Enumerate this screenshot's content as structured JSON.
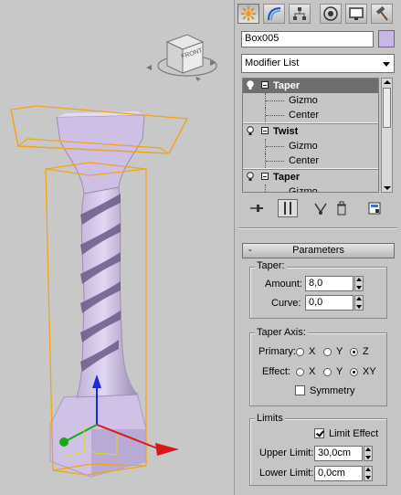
{
  "viewport": {
    "viewcube_face": "FRONT"
  },
  "command_panel": {
    "tabs": [
      {
        "name": "create",
        "icon": "sun-icon"
      },
      {
        "name": "modify",
        "icon": "modify-arc-icon"
      },
      {
        "name": "hierarchy",
        "icon": "hierarchy-icon"
      },
      {
        "name": "motion",
        "icon": "motion-icon"
      },
      {
        "name": "display",
        "icon": "display-monitor-icon"
      },
      {
        "name": "utilities",
        "icon": "hammer-icon"
      }
    ],
    "object_name": "Box005",
    "object_color": "#c8b6e8",
    "modifier_list_label": "Modifier List",
    "stack": [
      {
        "label": "Taper",
        "type": "modifier",
        "selected": true
      },
      {
        "label": "Gizmo",
        "type": "sub"
      },
      {
        "label": "Center",
        "type": "sub"
      },
      {
        "label": "Twist",
        "type": "modifier"
      },
      {
        "label": "Gizmo",
        "type": "sub"
      },
      {
        "label": "Center",
        "type": "sub"
      },
      {
        "label": "Taper",
        "type": "modifier"
      },
      {
        "label": "Gizmo",
        "type": "sub"
      }
    ]
  },
  "parameters": {
    "rollout_sign": "-",
    "rollout_title": "Parameters",
    "taper_group": "Taper:",
    "amount_label": "Amount:",
    "amount_value": "8,0",
    "curve_label": "Curve:",
    "curve_value": "0,0",
    "axis_group": "Taper Axis:",
    "primary_label": "Primary:",
    "effect_label": "Effect:",
    "primary_options": [
      "X",
      "Y",
      "Z"
    ],
    "primary_selected": "Z",
    "effect_options": [
      "X",
      "Y",
      "XY"
    ],
    "effect_selected": "XY",
    "symmetry_label": "Symmetry",
    "symmetry_checked": false,
    "limits_group": "Limits",
    "limit_effect_label": "Limit Effect",
    "limit_effect_checked": true,
    "upper_limit_label": "Upper Limit:",
    "upper_limit_value": "30,0cm",
    "lower_limit_label": "Lower Limit:",
    "lower_limit_value": "0,0cm"
  }
}
